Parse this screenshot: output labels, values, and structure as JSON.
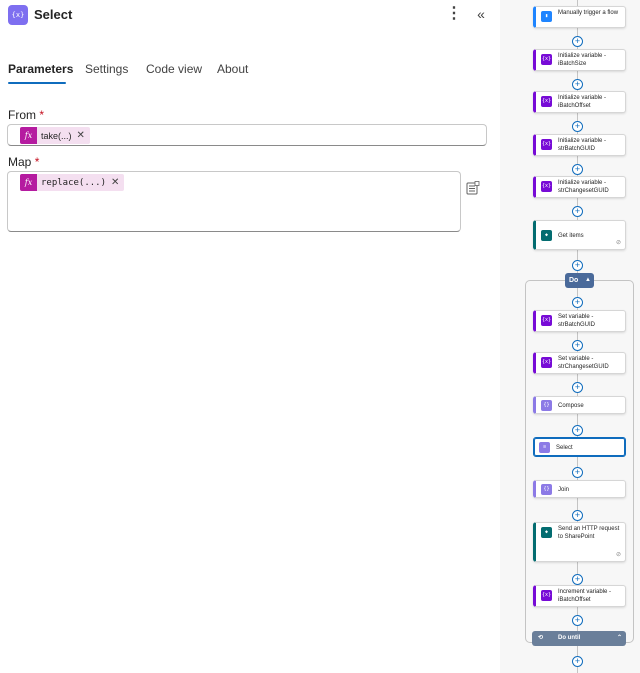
{
  "header": {
    "icon_text": "{x}",
    "title": "Select",
    "more_glyph": "⋮",
    "collapse_glyph": "«"
  },
  "tabs": [
    {
      "label": "Parameters",
      "active": true
    },
    {
      "label": "Settings",
      "active": false
    },
    {
      "label": "Code view",
      "active": false
    },
    {
      "label": "About",
      "active": false
    }
  ],
  "params": {
    "from_label": "From",
    "map_label": "Map",
    "required_mark": "*",
    "from_token": {
      "fx": "fx",
      "text": "take(...)",
      "remove": "✕"
    },
    "map_token": {
      "fx": "fx",
      "text": "replace(...)",
      "remove": "✕"
    }
  },
  "flow": {
    "steps": [
      {
        "name": "Manually trigger a flow",
        "icon": "trigger-icon",
        "color": "#1f85ff"
      },
      {
        "name": "Initialize variable - iBatchSize",
        "icon": "variable-icon",
        "color": "#770bd6"
      },
      {
        "name": "Initialize variable - iBatchOffset",
        "icon": "variable-icon",
        "color": "#770bd6"
      },
      {
        "name": "Initialize variable - strBatchGUID",
        "icon": "variable-icon",
        "color": "#770bd6"
      },
      {
        "name": "Initialize variable - strChangesetGUID",
        "icon": "variable-icon",
        "color": "#770bd6"
      },
      {
        "name": "Get items",
        "icon": "sharepoint-icon",
        "color": "#036c70"
      }
    ],
    "do_label": "Do",
    "inner_steps": [
      {
        "name": "Set variable - strBatchGUID",
        "icon": "variable-icon",
        "color": "#770bd6"
      },
      {
        "name": "Set variable - strChangesetGUID",
        "icon": "variable-icon",
        "color": "#770bd6"
      },
      {
        "name": "Compose",
        "icon": "compose-icon",
        "color": "#8c7ae6"
      },
      {
        "name": "Select",
        "icon": "select-icon",
        "color": "#8c7ae6"
      },
      {
        "name": "Join",
        "icon": "join-icon",
        "color": "#8c7ae6"
      },
      {
        "name": "Send an HTTP request to SharePoint",
        "icon": "sharepoint-icon",
        "color": "#036c70"
      },
      {
        "name": "Increment variable - iBatchOffset",
        "icon": "variable-icon",
        "color": "#770bd6"
      }
    ],
    "do_until_label": "Do until",
    "plus_glyph": "+",
    "link_glyph": "⊘"
  }
}
